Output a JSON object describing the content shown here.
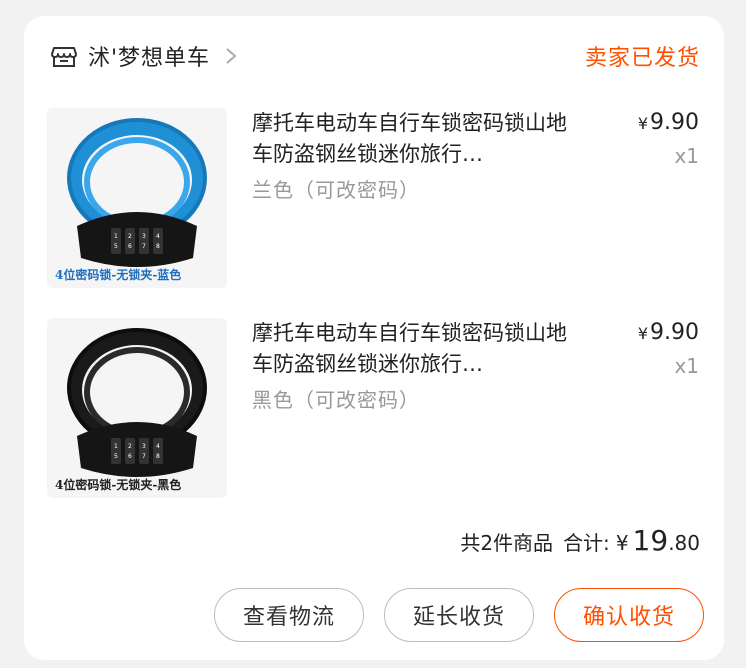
{
  "shop": {
    "name": "沭'梦想单车",
    "icon": "store-icon",
    "status": "卖家已发货"
  },
  "items": [
    {
      "title": "摩托车电动车自行车锁密码锁山地车防盗钢丝锁迷你旅行…",
      "sku": "兰色（可改密码）",
      "price_currency": "¥",
      "price": "9.90",
      "qty": "x1",
      "image_caption": "4位密码锁-无锁夹-蓝色",
      "color": "#1f8fd6"
    },
    {
      "title": "摩托车电动车自行车锁密码锁山地车防盗钢丝锁迷你旅行…",
      "sku": "黑色（可改密码）",
      "price_currency": "¥",
      "price": "9.90",
      "qty": "x1",
      "image_caption": "4位密码锁-无锁夹-黑色",
      "color": "#1a1a1a"
    }
  ],
  "summary": {
    "count_label": "共2件商品",
    "total_label": "合计:",
    "currency": "¥",
    "total_int": "19",
    "total_dec": ".80"
  },
  "actions": {
    "view_logistics": "查看物流",
    "extend_receipt": "延长收货",
    "confirm_receipt": "确认收货"
  },
  "colors": {
    "accent": "#ff5000",
    "text": "#222222",
    "muted": "#999999"
  }
}
